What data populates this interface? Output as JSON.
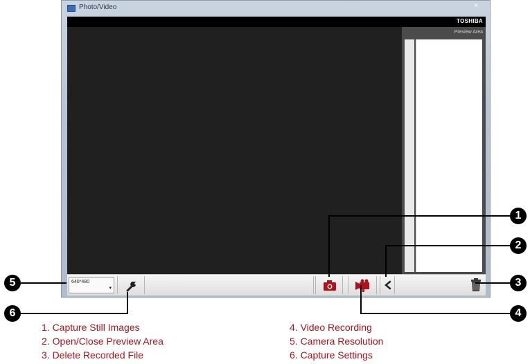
{
  "window": {
    "title": "Photo/Video",
    "close_glyph": "×",
    "brand": "TOSHIBA",
    "preview_label": "Preview Area"
  },
  "toolbar": {
    "resolution_value": "640*480",
    "resolution_arrow": "▾",
    "icons": [
      "wrench-icon",
      "camera-icon",
      "video-camera-icon",
      "chevron-left-icon",
      "trash-icon"
    ]
  },
  "colors": {
    "accent_red": "#b0121b",
    "viewport": "#202020",
    "window_chrome": "#b6c4d3"
  },
  "callouts": [
    "1",
    "2",
    "3",
    "4",
    "5",
    "6"
  ],
  "legend": [
    "1. Capture Still Images",
    "2. Open/Close Preview Area",
    "3. Delete Recorded File",
    "4. Video Recording",
    "5. Camera Resolution",
    "6. Capture Settings"
  ]
}
